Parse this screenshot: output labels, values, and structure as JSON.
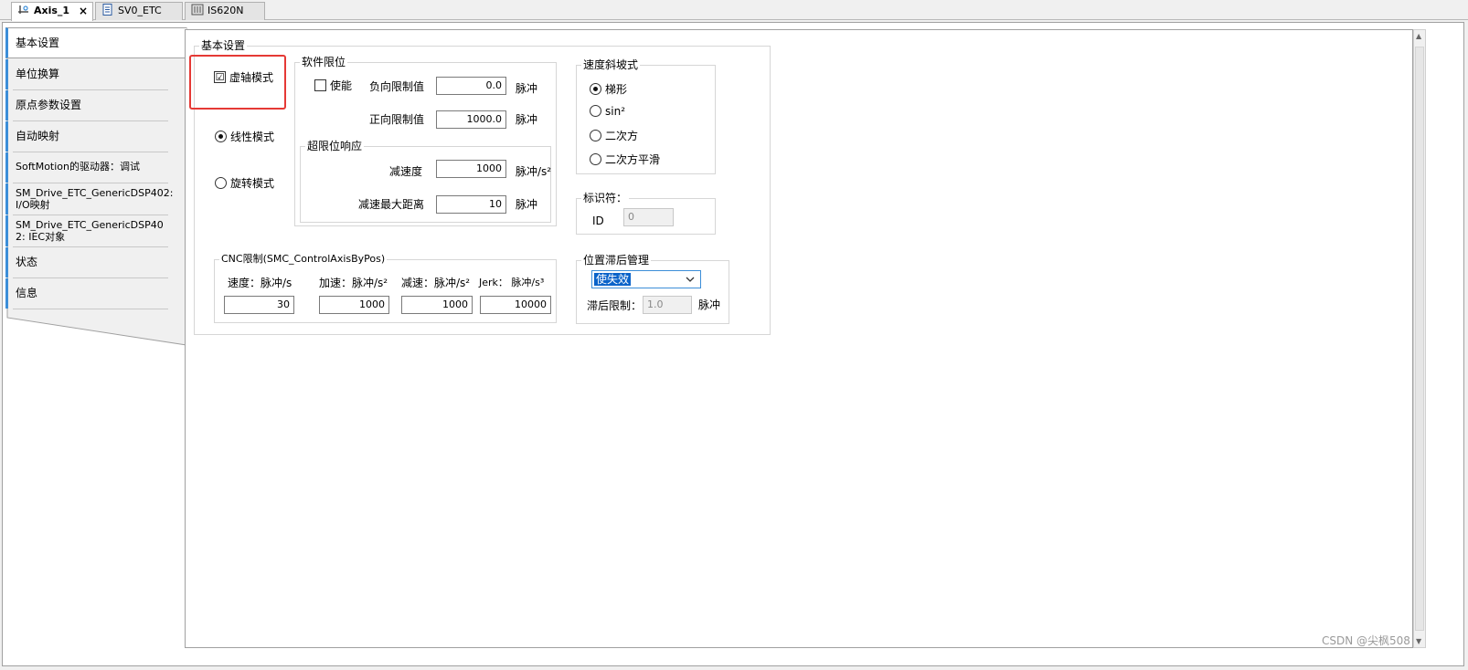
{
  "tabs": [
    {
      "label": "Axis_1",
      "close": "×"
    },
    {
      "label": "SV0_ETC"
    },
    {
      "label": "IS620N"
    }
  ],
  "nav": {
    "items": [
      "基本设置",
      "单位换算",
      "原点参数设置",
      "自动映射",
      "SoftMotion的驱动器：调试",
      "SM_Drive_ETC_GenericDSP402: I/O映射",
      "SM_Drive_ETC_GenericDSP402: IEC对象",
      "状态",
      "信息"
    ]
  },
  "basic": {
    "title": "基本设置",
    "virtual_axis": {
      "label": "虚轴模式",
      "checked": "☑"
    },
    "linear_mode": "线性模式",
    "rotary_mode": "旋转模式"
  },
  "soft_limit": {
    "title": "软件限位",
    "enable": "使能",
    "neg_label": "负向限制值",
    "neg_value": "0.0",
    "pos_label": "正向限制值",
    "pos_value": "1000.0",
    "unit": "脉冲",
    "overrun": {
      "title": "超限位响应",
      "decel_label": "减速度",
      "decel_value": "1000",
      "decel_unit": "脉冲/s²",
      "max_dist_label": "减速最大距离",
      "max_dist_value": "10",
      "max_dist_unit": "脉冲"
    }
  },
  "ramp": {
    "title": "速度斜坡式",
    "options": [
      "梯形",
      "sin²",
      "二次方",
      "二次方平滑"
    ]
  },
  "identifier": {
    "title": "标识符：",
    "id_label": "ID",
    "id_value": "0"
  },
  "cnc": {
    "title": "CNC限制(SMC_ControlAxisByPos)",
    "speed_label": "速度：脉冲/s",
    "speed_value": "30",
    "accel_label": "加速：脉冲/s²",
    "accel_value": "1000",
    "decel_label": "减速：脉冲/s²",
    "decel_value": "1000",
    "jerk_label": "Jerk：  脉冲/s³",
    "jerk_value": "10000"
  },
  "lag": {
    "title": "位置滞后管理",
    "select_value": "使失效",
    "limit_label": "滞后限制：",
    "limit_value": "1.0",
    "limit_unit": "脉冲"
  },
  "watermark": "CSDN @尖枫508",
  "colors": {
    "accent": "#3c8ed8",
    "highlight": "#e53935",
    "selection": "#0a63c9"
  }
}
